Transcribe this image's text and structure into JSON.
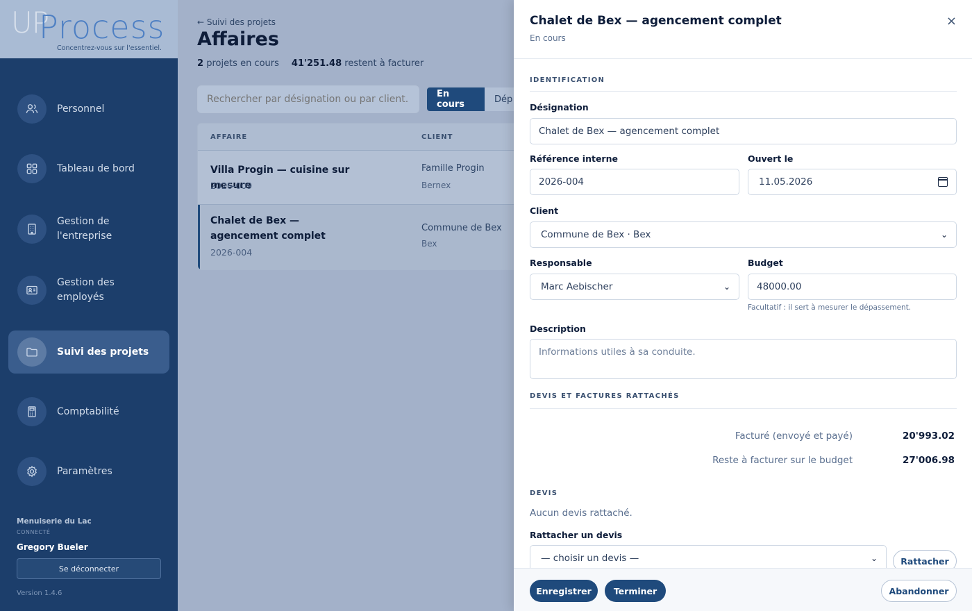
{
  "brand": {
    "logo_up": "UP",
    "logo_process": "Process",
    "tagline": "Concentrez-vous sur l'essentiel."
  },
  "sidebar": {
    "items": [
      {
        "label": "Personnel",
        "icon": "users-icon"
      },
      {
        "label": "Tableau de bord",
        "icon": "dashboard-grid-icon"
      },
      {
        "label": "Gestion de l'entreprise",
        "icon": "building-icon"
      },
      {
        "label": "Gestion des employés",
        "icon": "id-card-icon"
      },
      {
        "label": "Suivi des projets",
        "icon": "folder-icon",
        "active": true
      },
      {
        "label": "Comptabilité",
        "icon": "calculator-icon"
      },
      {
        "label": "Paramètres",
        "icon": "gear-icon"
      }
    ],
    "company": "Menuiserie du Lac",
    "status": "CONNECTÉ",
    "user": "Gregory Bueler",
    "logout": "Se déconnecter",
    "version": "Version 1.4.6"
  },
  "main": {
    "back": "← Suivi des projets",
    "title": "Affaires",
    "summary": {
      "count": "2",
      "count_label": "projets en cours",
      "amount": "41'251.48",
      "amount_label": "restent à facturer"
    },
    "search_placeholder": "Rechercher par désignation ou par client.",
    "filters": {
      "active": "En cours",
      "next": "Dép"
    },
    "table": {
      "headers": {
        "affaire": "AFFAIRE",
        "client": "CLIENT"
      },
      "rows": [
        {
          "title": "Villa Progin — cuisine sur mesure",
          "ref": "2026-009",
          "client": "Famille Progin",
          "city": "Bernex"
        },
        {
          "title": "Chalet de Bex — agencement complet",
          "ref": "2026-004",
          "client": "Commune de Bex",
          "city": "Bex"
        }
      ]
    }
  },
  "panel": {
    "title": "Chalet de Bex — agencement complet",
    "status": "En cours",
    "close": "×",
    "identification": "IDENTIFICATION",
    "designation_label": "Désignation",
    "designation_value": "Chalet de Bex — agencement complet",
    "ref_label": "Référence interne",
    "ref_value": "2026-004",
    "opened_label": "Ouvert le",
    "opened_value": "11.05.2026",
    "client_label": "Client",
    "client_value": "Commune de Bex · Bex",
    "responsable_label": "Responsable",
    "responsable_value": "Marc Aebischer",
    "budget_label": "Budget",
    "budget_value": "48000.00",
    "budget_hint": "Facultatif : il sert à mesurer le dépassement.",
    "description_label": "Description",
    "description_placeholder": "Informations utiles à sa conduite.",
    "attached_section": "DEVIS ET FACTURES RATTACHÉS",
    "invoiced_label": "Facturé (envoyé et payé)",
    "invoiced_value": "20'993.02",
    "remaining_label": "Reste à facturer sur le budget",
    "remaining_value": "27'006.98",
    "devis_section": "DEVIS",
    "no_devis": "Aucun devis rattaché.",
    "attach_label": "Rattacher un devis",
    "attach_select": "— choisir un devis —",
    "attach_button": "Rattacher",
    "save_button": "Enregistrer",
    "finish_button": "Terminer",
    "cancel_button": "Abandonner"
  }
}
